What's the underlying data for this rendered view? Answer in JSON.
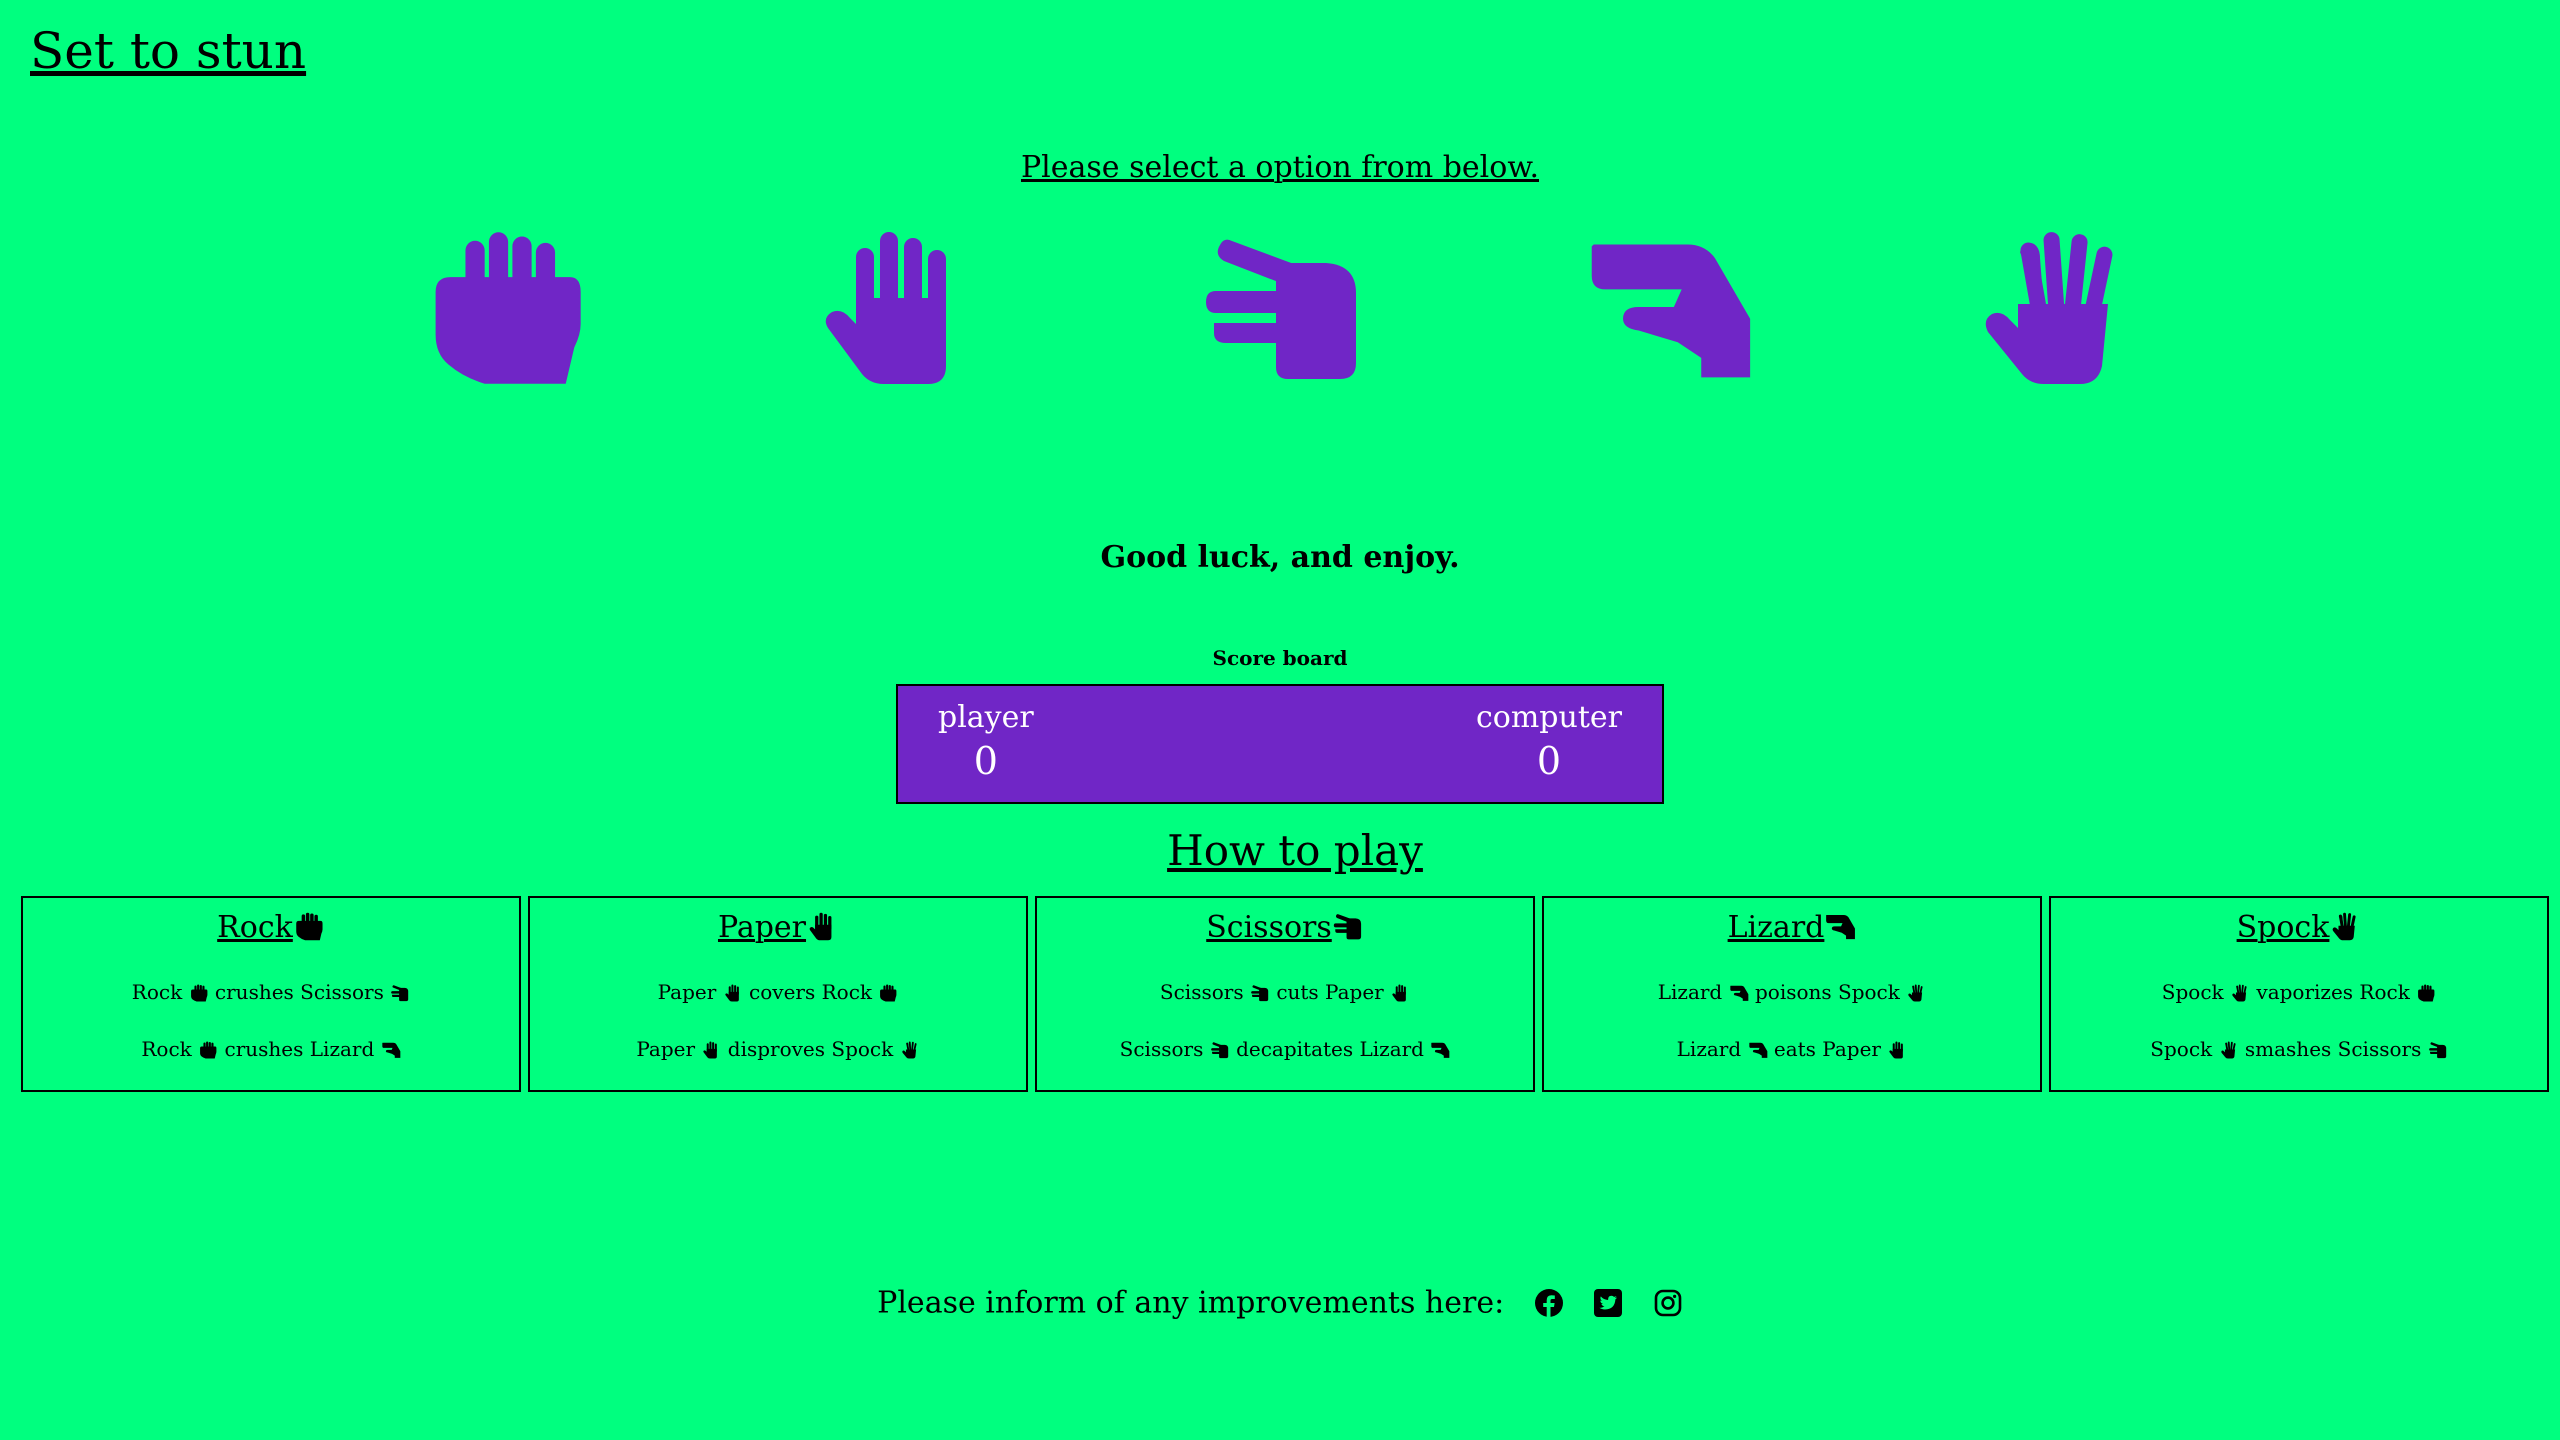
{
  "page": {
    "title": "Set to stun",
    "prompt": "Please select a option from below.",
    "good_luck": "Good luck, and enjoy."
  },
  "colors": {
    "background": "#00ff7f",
    "accent": "#7026c6"
  },
  "choices": [
    {
      "name": "Rock",
      "icon": "rock-hand-icon"
    },
    {
      "name": "Paper",
      "icon": "paper-hand-icon"
    },
    {
      "name": "Scissors",
      "icon": "scissors-hand-icon"
    },
    {
      "name": "Lizard",
      "icon": "lizard-hand-icon"
    },
    {
      "name": "Spock",
      "icon": "spock-hand-icon"
    }
  ],
  "scoreboard": {
    "label": "Score board",
    "player_label": "player",
    "player_score": "0",
    "computer_label": "computer",
    "computer_score": "0"
  },
  "how_to_play": {
    "title": "How to play",
    "cards": [
      {
        "title": "Rock",
        "rules": [
          [
            "Rock",
            "crushes Scissors"
          ],
          [
            "Rock",
            "crushes Lizard"
          ]
        ]
      },
      {
        "title": "Paper",
        "rules": [
          [
            "Paper",
            "covers Rock"
          ],
          [
            "Paper",
            "disproves Spock"
          ]
        ]
      },
      {
        "title": "Scissors",
        "rules": [
          [
            "Scissors",
            "cuts Paper"
          ],
          [
            "Scissors",
            "decapitates Lizard"
          ]
        ]
      },
      {
        "title": "Lizard",
        "rules": [
          [
            "Lizard",
            "poisons Spock"
          ],
          [
            "Lizard",
            "eats Paper"
          ]
        ]
      },
      {
        "title": "Spock",
        "rules": [
          [
            "Spock",
            "vaporizes Rock"
          ],
          [
            "Spock",
            "smashes Scissors"
          ]
        ]
      }
    ]
  },
  "footer": {
    "text": "Please inform of any improvements here:",
    "social": [
      "facebook-icon",
      "twitter-icon",
      "instagram-icon"
    ]
  }
}
